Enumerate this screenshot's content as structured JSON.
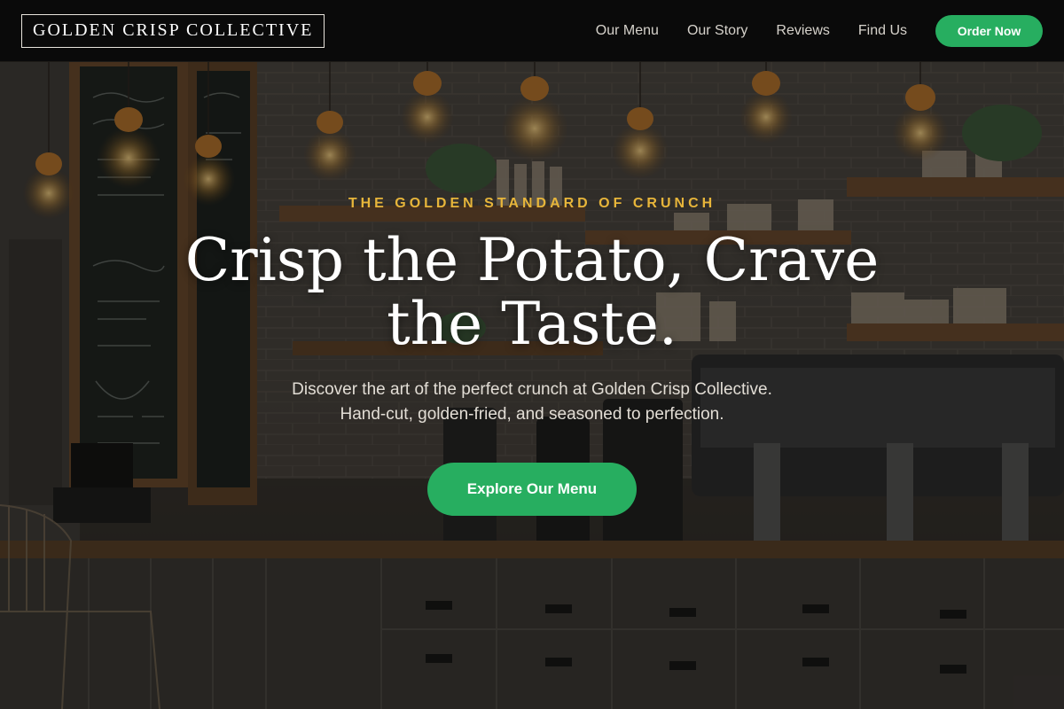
{
  "header": {
    "logo": "GOLDEN CRISP COLLECTIVE",
    "nav": [
      {
        "label": "Our Menu"
      },
      {
        "label": "Our Story"
      },
      {
        "label": "Reviews"
      },
      {
        "label": "Find Us"
      }
    ],
    "cta": "Order Now"
  },
  "hero": {
    "eyebrow": "THE GOLDEN STANDARD OF CRUNCH",
    "title_line1": "Crisp the Potato, Crave",
    "title_line2": "the Taste.",
    "subtitle_line1": "Discover the art of the perfect crunch at Golden Crisp Collective.",
    "subtitle_line2": "Hand-cut, golden-fried, and seasoned to perfection.",
    "button": "Explore Our Menu"
  },
  "colors": {
    "accent_green": "#27ae60",
    "accent_gold": "#e7b53a",
    "header_bg": "#0a0a0a"
  }
}
